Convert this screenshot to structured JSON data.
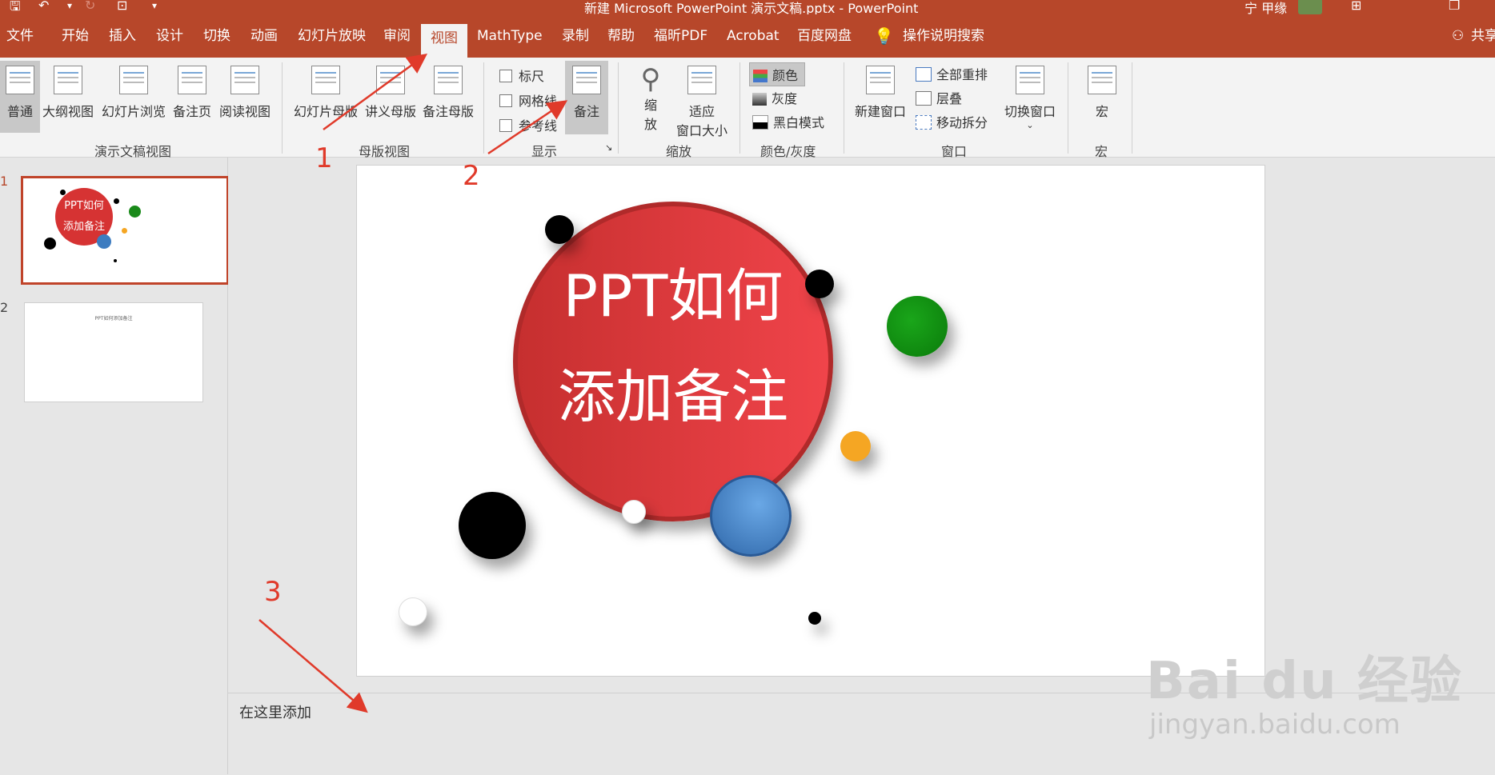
{
  "titlebar": {
    "doc_title": "新建 Microsoft PowerPoint 演示文稿.pptx  -  PowerPoint",
    "user": "宁 甲缘"
  },
  "tabs": [
    {
      "label": "文件"
    },
    {
      "label": "开始"
    },
    {
      "label": "插入"
    },
    {
      "label": "设计"
    },
    {
      "label": "切换"
    },
    {
      "label": "动画"
    },
    {
      "label": "幻灯片放映"
    },
    {
      "label": "审阅"
    },
    {
      "label": "视图"
    },
    {
      "label": "MathType"
    },
    {
      "label": "录制"
    },
    {
      "label": "帮助"
    },
    {
      "label": "福昕PDF"
    },
    {
      "label": "Acrobat"
    },
    {
      "label": "百度网盘"
    }
  ],
  "tell_me": "操作说明搜索",
  "share": "共享",
  "ribbon": {
    "presentation_views": {
      "group": "演示文稿视图",
      "buttons": [
        "普通",
        "大纲视图",
        "幻灯片浏览",
        "备注页",
        "阅读视图"
      ]
    },
    "master_views": {
      "group": "母版视图",
      "buttons": [
        "幻灯片母版",
        "讲义母版",
        "备注母版"
      ]
    },
    "show": {
      "group": "显示",
      "checks": [
        "标尺",
        "网格线",
        "参考线"
      ],
      "notes_button": "备注"
    },
    "zoom": {
      "group": "缩放",
      "zoom_label_1": "缩",
      "zoom_label_2": "放",
      "fit_label_1": "适应",
      "fit_label_2": "窗口大小"
    },
    "color": {
      "group": "颜色/灰度",
      "items": [
        "颜色",
        "灰度",
        "黑白模式"
      ]
    },
    "window": {
      "group": "窗口",
      "new_window": "新建窗口",
      "items": [
        "全部重排",
        "层叠",
        "移动拆分"
      ],
      "switch": "切换窗口"
    },
    "macros": {
      "group": "宏",
      "button": "宏"
    }
  },
  "thumbnails": [
    {
      "number": "1",
      "text_line1": "PPT如何",
      "text_line2": "添加备注"
    },
    {
      "number": "2",
      "text": "PPT如何添加备注"
    }
  ],
  "slide": {
    "title_line1": "PPT如何",
    "title_line2": "添加备注"
  },
  "notes": {
    "text": "在这里添加"
  },
  "annotations": [
    "1",
    "2",
    "3"
  ],
  "watermark": {
    "logo": "Bai du 经验",
    "url": "jingyan.baidu.com"
  },
  "colors": {
    "brand": "#b7472a",
    "annotation": "#e03a2a",
    "ribbon_bg": "#f3f3f3"
  }
}
